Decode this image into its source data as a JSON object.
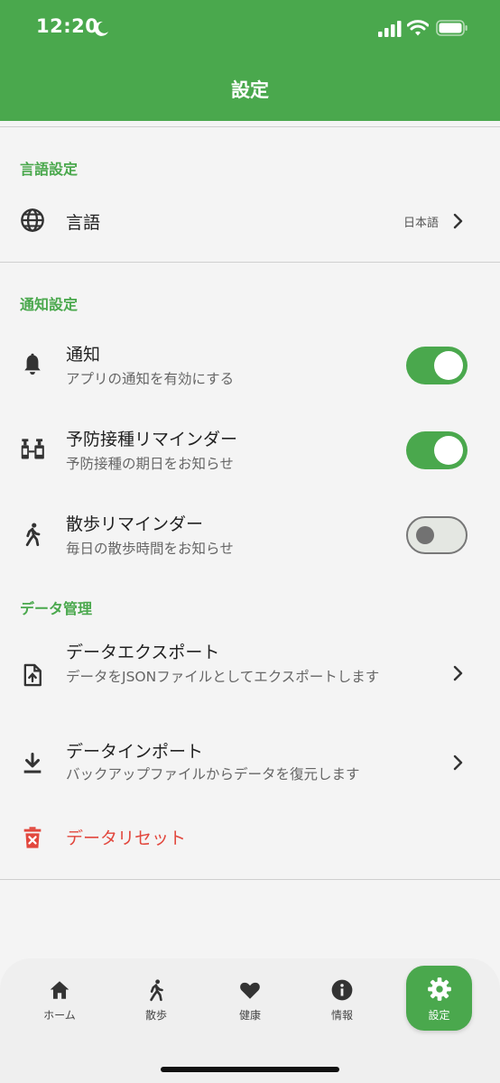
{
  "status_bar": {
    "time": "12:20"
  },
  "header": {
    "title": "設定"
  },
  "sections": {
    "language": {
      "title": "言語設定",
      "language_row": {
        "label": "言語",
        "value": "日本語"
      }
    },
    "notifications": {
      "title": "通知設定",
      "items": [
        {
          "label": "通知",
          "subtitle": "アプリの通知を有効にする",
          "enabled": true
        },
        {
          "label": "予防接種リマインダー",
          "subtitle": "予防接種の期日をお知らせ",
          "enabled": true
        },
        {
          "label": "散歩リマインダー",
          "subtitle": "毎日の散歩時間をお知らせ",
          "enabled": false
        }
      ]
    },
    "data": {
      "title": "データ管理",
      "export": {
        "label": "データエクスポート",
        "subtitle": "データをJSONファイルとしてエクスポートします"
      },
      "import": {
        "label": "データインポート",
        "subtitle": "バックアップファイルからデータを復元します"
      },
      "reset": {
        "label": "データリセット"
      }
    }
  },
  "bottom_nav": {
    "items": [
      {
        "label": "ホーム",
        "icon": "home-icon"
      },
      {
        "label": "散歩",
        "icon": "walk-icon"
      },
      {
        "label": "健康",
        "icon": "heart-icon"
      },
      {
        "label": "情報",
        "icon": "info-icon"
      },
      {
        "label": "設定",
        "icon": "gear-icon",
        "active": true
      }
    ]
  },
  "colors": {
    "primary": "#4aa84d",
    "danger": "#e2473d",
    "background": "#f4f4f4"
  }
}
